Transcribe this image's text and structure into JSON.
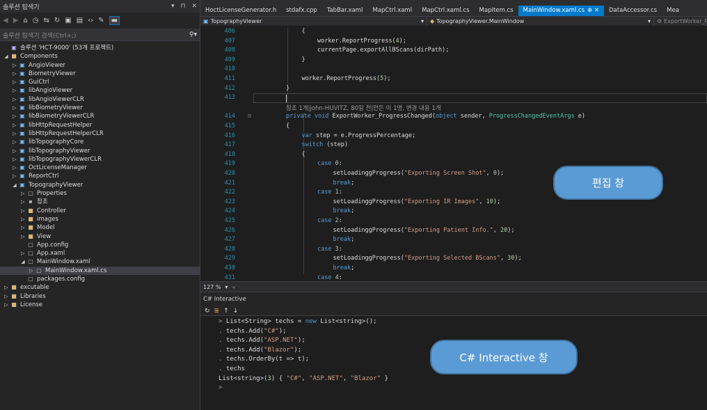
{
  "solution_explorer": {
    "title": "솔루션 탐색기",
    "title_buttons": [
      "▾",
      "⊓",
      "✕"
    ],
    "search_placeholder": "솔루션 탐색기 검색(Ctrl+;)",
    "tree": [
      {
        "label": "솔루션 'HCT-9000' (53개 프로젝트)",
        "level": 0,
        "expander": "",
        "icon": "sol"
      },
      {
        "label": "Components",
        "level": 0,
        "expander": "◢",
        "icon": "folder"
      },
      {
        "label": "AngioViewer",
        "level": 1,
        "expander": "▷",
        "icon": "proj"
      },
      {
        "label": "BiometryViewer",
        "level": 1,
        "expander": "▷",
        "icon": "proj"
      },
      {
        "label": "GuiCtrl",
        "level": 1,
        "expander": "▷",
        "icon": "proj"
      },
      {
        "label": "libAngioViewer",
        "level": 1,
        "expander": "▷",
        "icon": "proj"
      },
      {
        "label": "libAngioViewerCLR",
        "level": 1,
        "expander": "▷",
        "icon": "proj"
      },
      {
        "label": "libBiometryViewer",
        "level": 1,
        "expander": "▷",
        "icon": "proj"
      },
      {
        "label": "libBiometryViewerCLR",
        "level": 1,
        "expander": "▷",
        "icon": "proj"
      },
      {
        "label": "libHttpRequestHelper",
        "level": 1,
        "expander": "▷",
        "icon": "proj"
      },
      {
        "label": "libHttpRequestHelperCLR",
        "level": 1,
        "expander": "▷",
        "icon": "proj"
      },
      {
        "label": "libTopographyCore",
        "level": 1,
        "expander": "▷",
        "icon": "proj"
      },
      {
        "label": "libTopographyViewer",
        "level": 1,
        "expander": "▷",
        "icon": "proj"
      },
      {
        "label": "libTopographyViewerCLR",
        "level": 1,
        "expander": "▷",
        "icon": "proj"
      },
      {
        "label": "OctLicenseManager",
        "level": 1,
        "expander": "▷",
        "icon": "proj"
      },
      {
        "label": "ReportCtrl",
        "level": 1,
        "expander": "▷",
        "icon": "proj"
      },
      {
        "label": "TopographyViewer",
        "level": 1,
        "expander": "◢",
        "icon": "proj"
      },
      {
        "label": "Properties",
        "level": 2,
        "expander": "▷",
        "icon": "file"
      },
      {
        "label": "참조",
        "level": 2,
        "expander": "▷",
        "icon": "ref"
      },
      {
        "label": "Controller",
        "level": 2,
        "expander": "▷",
        "icon": "folder"
      },
      {
        "label": "images",
        "level": 2,
        "expander": "▷",
        "icon": "folder"
      },
      {
        "label": "Model",
        "level": 2,
        "expander": "▷",
        "icon": "folder"
      },
      {
        "label": "View",
        "level": 2,
        "expander": "▷",
        "icon": "folder"
      },
      {
        "label": "App.config",
        "level": 2,
        "expander": "",
        "icon": "file"
      },
      {
        "label": "App.xaml",
        "level": 2,
        "expander": "▷",
        "icon": "file"
      },
      {
        "label": "MainWindow.xaml",
        "level": 2,
        "expander": "◢",
        "icon": "file"
      },
      {
        "label": "MainWindow.xaml.cs",
        "level": 3,
        "expander": "▷",
        "icon": "file",
        "selected": true
      },
      {
        "label": "packages.config",
        "level": 2,
        "expander": "",
        "icon": "file"
      },
      {
        "label": "excutable",
        "level": 0,
        "expander": "▷",
        "icon": "folder"
      },
      {
        "label": "Libraries",
        "level": 0,
        "expander": "▷",
        "icon": "folder"
      },
      {
        "label": "License",
        "level": 0,
        "expander": "▷",
        "icon": "folder"
      }
    ]
  },
  "tabs": [
    {
      "label": "HoctLicenseGenerator.h"
    },
    {
      "label": "stdafx.cpp"
    },
    {
      "label": "TabBar.xaml"
    },
    {
      "label": "MapCtrl.xaml"
    },
    {
      "label": "MapCtrl.xaml.cs"
    },
    {
      "label": "MapItem.cs"
    },
    {
      "label": "MainWindow.xaml.cs",
      "active": true,
      "close_glyphs": "⊕ ✕"
    },
    {
      "label": "DataAccessor.cs"
    },
    {
      "label": "Mea"
    }
  ],
  "navbar": {
    "project": "TopographyViewer",
    "class": "TopographyViewer.MainWindow",
    "member": "ExportWorker_Pro"
  },
  "editor": {
    "lines": [
      {
        "n": "406",
        "t": "{",
        "indent": 1
      },
      {
        "n": "407",
        "t": "worker.ReportProgress(4);",
        "indent": 2
      },
      {
        "n": "408",
        "t": "currentPage.exportAllBScans(dirPath);",
        "indent": 2
      },
      {
        "n": "409",
        "t": "}",
        "indent": 1
      },
      {
        "n": "410",
        "t": "",
        "indent": 0
      },
      {
        "n": "411",
        "t": "worker.ReportProgress(5);",
        "indent": 1
      },
      {
        "n": "412",
        "t": "}",
        "indent": 0
      },
      {
        "n": "413",
        "t": "",
        "indent": 0,
        "caret": true
      },
      {
        "n": "",
        "t": "참조 1개|john-HUVITZ, 80일 전|만든 이 1명, 변경 내용 1개",
        "indent": 0,
        "lens": true
      },
      {
        "n": "414",
        "t": "private void ExportWorker_ProgressChanged(object sender, ProgressChangedEventArgs e)",
        "indent": 0,
        "fold": true
      },
      {
        "n": "415",
        "t": "{",
        "indent": 0
      },
      {
        "n": "416",
        "t": "var step = e.ProgressPercentage;",
        "indent": 1
      },
      {
        "n": "417",
        "t": "switch (step)",
        "indent": 1
      },
      {
        "n": "418",
        "t": "{",
        "indent": 1
      },
      {
        "n": "419",
        "t": "case 0:",
        "indent": 2
      },
      {
        "n": "420",
        "t": "setLoadinggProgress(\"Exporting Screen Shot\", 0);",
        "indent": 3
      },
      {
        "n": "421",
        "t": "break;",
        "indent": 3
      },
      {
        "n": "422",
        "t": "case 1:",
        "indent": 2
      },
      {
        "n": "423",
        "t": "setLoadinggProgress(\"Exporting IR Images\", 10);",
        "indent": 3
      },
      {
        "n": "424",
        "t": "break;",
        "indent": 3
      },
      {
        "n": "425",
        "t": "case 2:",
        "indent": 2
      },
      {
        "n": "426",
        "t": "setLoadinggProgress(\"Exporting Patient Info.\", 20);",
        "indent": 3
      },
      {
        "n": "427",
        "t": "break;",
        "indent": 3
      },
      {
        "n": "428",
        "t": "case 3:",
        "indent": 2
      },
      {
        "n": "429",
        "t": "setLoadinggProgress(\"Exporting Selected BScans\", 30);",
        "indent": 3
      },
      {
        "n": "430",
        "t": "break;",
        "indent": 3
      },
      {
        "n": "431",
        "t": "case 4:",
        "indent": 2
      }
    ]
  },
  "zoom": {
    "label": "127 %",
    "dropdown": "▾"
  },
  "interactive": {
    "title": "C# Interactive",
    "toolbar": [
      "↻",
      "≣",
      "↑",
      "↓"
    ],
    "lines": [
      "> List<String> techs = new List<string>();",
      ". techs.Add(\"C#\");",
      ". techs.Add(\"ASP.NET\");",
      ". techs.Add(\"Blazor\");",
      ". techs.OrderBy(t => t);",
      ". techs",
      "List<string>(3) { \"C#\", \"ASP.NET\", \"Blazor\" }",
      ">"
    ]
  },
  "callouts": {
    "edit": "편집 창",
    "interactive": "C# Interactive 창"
  },
  "colors": {
    "accent": "#007acc",
    "callout_fill": "#5b9bd5",
    "keyword": "#569cd6",
    "type": "#4ec9b0",
    "string": "#d69d85",
    "line_number": "#2b91af"
  }
}
